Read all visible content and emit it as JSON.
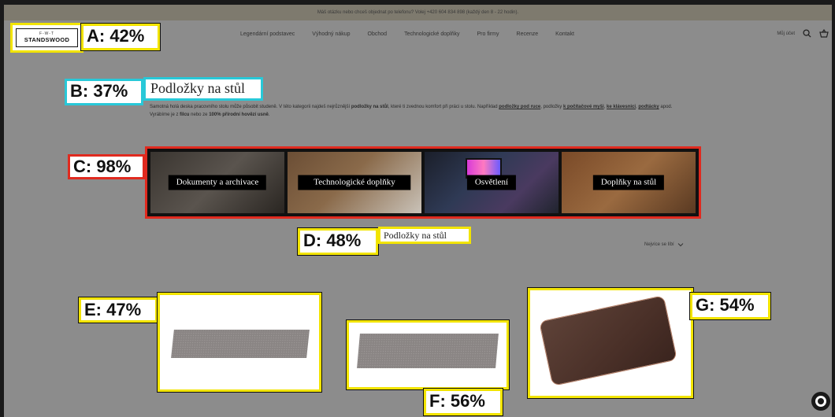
{
  "announcement": "Máš otázku nebo chceš objednat po telefonu? Volej +420 604 834 898 (každý den 8 - 22 hodin).",
  "logo": {
    "text": "STANDSWOOD",
    "mark": "F-W-T"
  },
  "nav": {
    "items": [
      "Legendární podstavec",
      "Výhodný nákup",
      "Obchod",
      "Technologické doplňky",
      "Pro firmy",
      "Recenze",
      "Kontakt"
    ]
  },
  "header": {
    "account": "Můj účet",
    "icons": [
      "search-icon",
      "cart-icon"
    ]
  },
  "page": {
    "title": "Podložky na stůl",
    "description_parts": {
      "p1": "Samotná holá deska pracovního stolu může působit studeně. V této kategorii najdeš nejrůznější",
      "b1": "podložky na stůl",
      "p2": ", které ti zvednou komfort při práci u stolu. Například",
      "l1": "podložky pod ruce",
      "p3": ", podložky",
      "l2": "k počítačové myši",
      "p4": ",",
      "l3": "ke klávesnici",
      "p5": ",",
      "l4": "podtácky",
      "p6": "apod. Vyrábíme je z",
      "b2": "filcu",
      "p7": "nebo ze",
      "b3": "100% přírodní hovězí usně",
      "p8": "."
    }
  },
  "categories": [
    {
      "label": "Dokumenty a archivace"
    },
    {
      "label": "Technologické doplňky"
    },
    {
      "label": "Osvětlení"
    },
    {
      "label": "Doplňky na stůl"
    }
  ],
  "section": {
    "title": "Podložky na stůl",
    "sort_label": "Nejvíce se líbí"
  },
  "annotations": {
    "A": "A: 42%",
    "B": "B: 37%",
    "C": "C: 98%",
    "D": "D: 48%",
    "E": "E: 47%",
    "F": "F: 56%",
    "G": "G: 54%"
  },
  "colors": {
    "tag_yellow": "#f2e400",
    "tag_cyan": "#28c8d8",
    "tag_red": "#e02a1f",
    "overlay_gray": "#8c8c8c"
  }
}
